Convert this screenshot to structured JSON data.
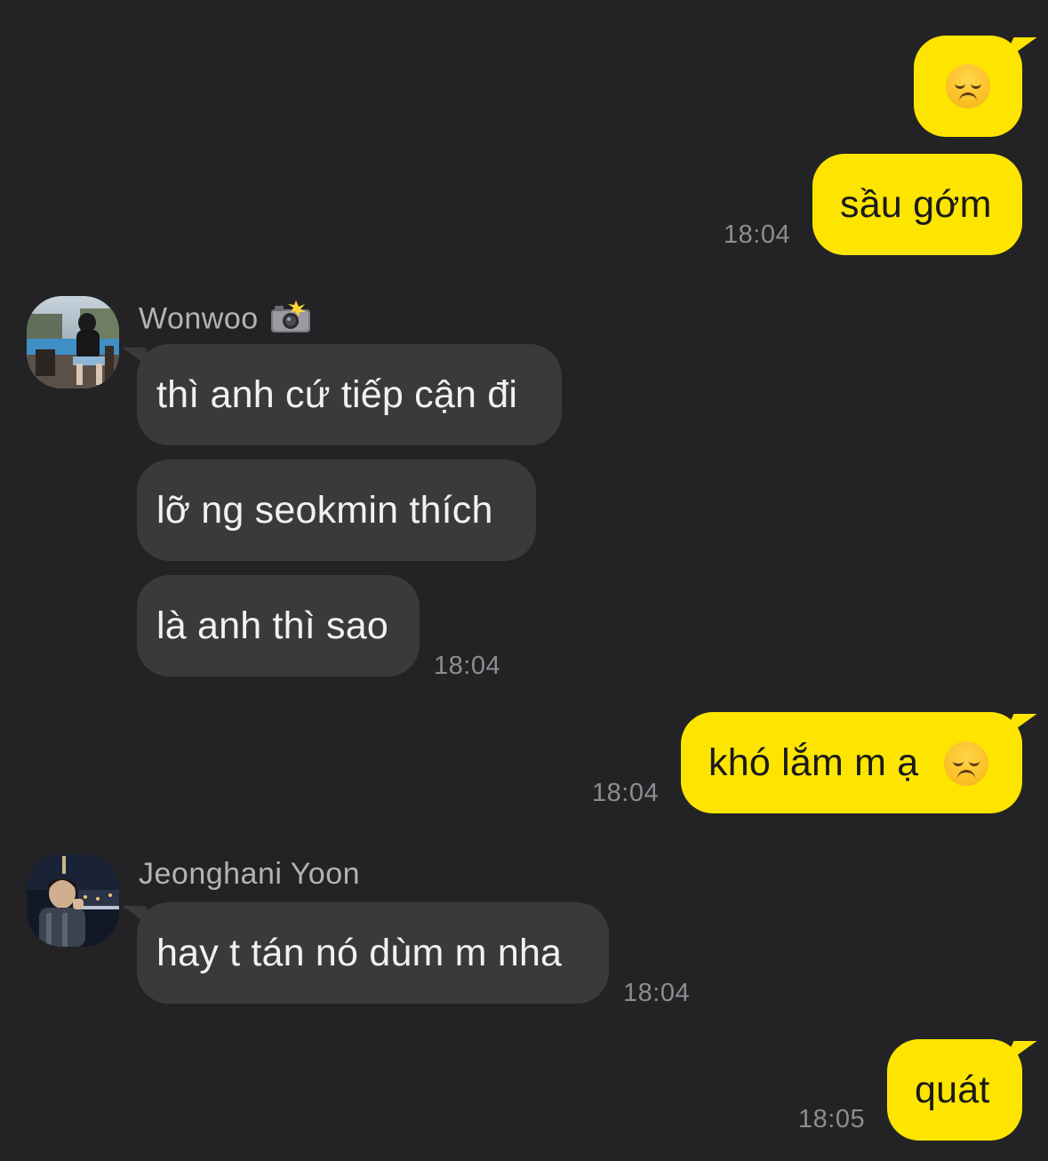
{
  "messages": [
    {
      "side": "me",
      "emoji": "sad-face"
    },
    {
      "side": "me",
      "text": "sầu gớm",
      "time": "18:04"
    },
    {
      "side": "them",
      "sender": "Wonwoo",
      "sender_badge": "camera-flash-icon",
      "text": "thì anh cứ tiếp cận đi"
    },
    {
      "side": "them",
      "text": "lỡ ng seokmin thích"
    },
    {
      "side": "them",
      "text": "là anh thì sao",
      "time": "18:04"
    },
    {
      "side": "me",
      "text": "khó lắm m ạ",
      "emoji": "sad-face",
      "time": "18:04"
    },
    {
      "side": "them",
      "sender": "Jeonghani Yoon",
      "text": "hay t tán nó dùm m nha",
      "time": "18:04"
    },
    {
      "side": "me",
      "text": "quát",
      "time": "18:05"
    }
  ],
  "colors": {
    "background": "#232325",
    "my_bubble": "#fde500",
    "their_bubble": "#3a3a3c",
    "time": "#8d8d91",
    "sender": "#b3b3b6"
  }
}
